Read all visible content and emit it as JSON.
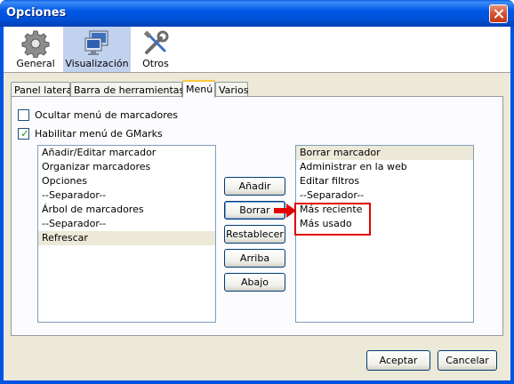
{
  "window": {
    "title": "Opciones"
  },
  "panes": [
    {
      "label": "General",
      "icon": "gear-icon"
    },
    {
      "label": "Visualización",
      "icon": "monitor-icon"
    },
    {
      "label": "Otros",
      "icon": "tools-icon"
    }
  ],
  "tabs": [
    "Panel lateral",
    "Barra de herramientas",
    "Menú",
    "Varios"
  ],
  "options": {
    "hide_bookmarks_menu": {
      "label": "Ocultar menú de marcadores",
      "checked": false
    },
    "enable_gmarks_menu": {
      "label": "Habilitar menú de GMarks",
      "checked": true
    }
  },
  "available_list": [
    "Añadir/Editar marcador",
    "Organizar marcadores",
    "Opciones",
    "--Separador--",
    "Árbol de marcadores",
    "--Separador--",
    "Refrescar"
  ],
  "selected_list": [
    "Borrar marcador",
    "Administrar en la web",
    "Editar filtros",
    "--Separador--",
    "Más reciente",
    "Más usado"
  ],
  "buttons": {
    "add": "Añadir",
    "remove": "Borrar",
    "reset": "Restablecer",
    "up": "Arriba",
    "down": "Abajo",
    "accept": "Aceptar",
    "cancel": "Cancelar"
  },
  "colors": {
    "annotation": "#e00000",
    "titlebar": "#0054e3",
    "selection": "#ece9d8"
  }
}
